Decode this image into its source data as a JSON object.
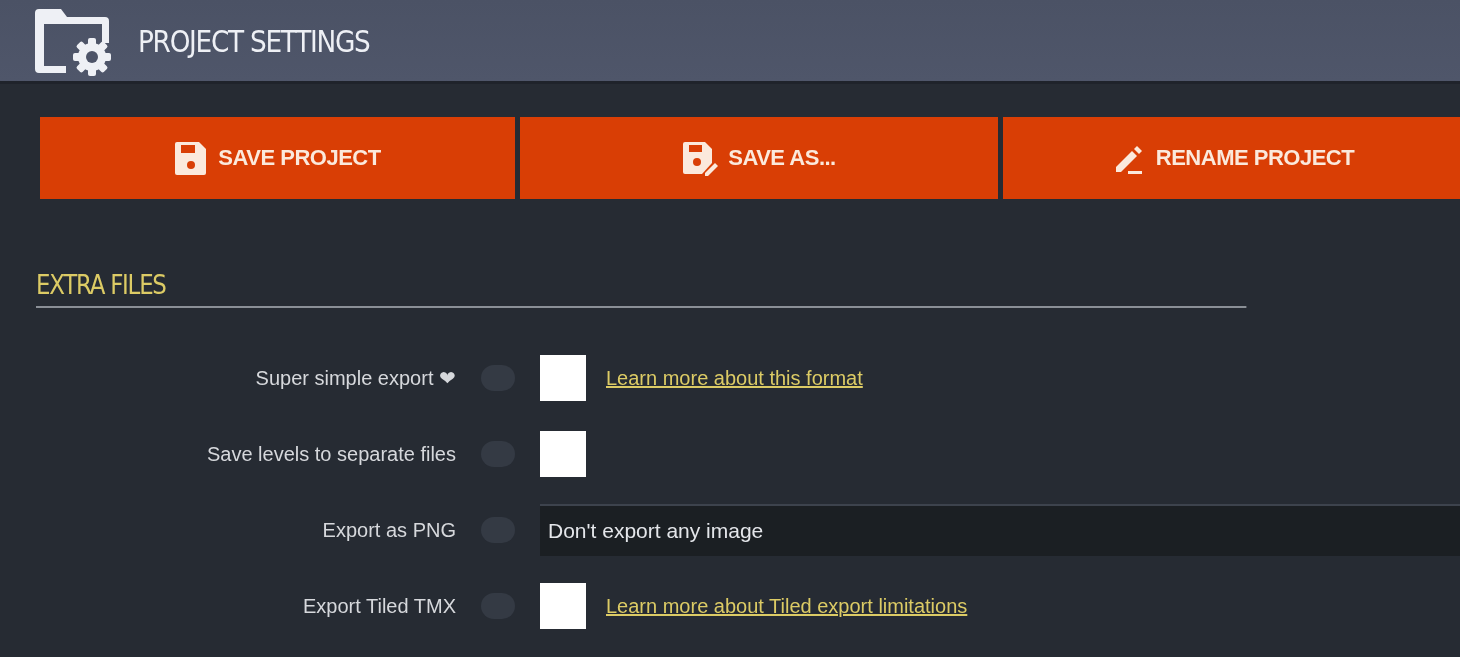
{
  "header": {
    "title": "PROJECT SETTINGS"
  },
  "actions": [
    {
      "kind": "save",
      "label": "SAVE PROJECT"
    },
    {
      "kind": "save-as",
      "label": "SAVE AS..."
    },
    {
      "kind": "rename",
      "label": "RENAME PROJECT"
    }
  ],
  "section": {
    "title": "EXTRA FILES",
    "rows": [
      {
        "kind": "checkbox",
        "label": "Super simple export ❤",
        "checked": false,
        "link": "Learn more about this format"
      },
      {
        "kind": "checkbox",
        "label": "Save levels to separate files",
        "checked": false
      },
      {
        "kind": "select",
        "label": "Export as PNG",
        "value": "Don't export any image"
      },
      {
        "kind": "checkbox",
        "label": "Export Tiled TMX",
        "checked": false,
        "link": "Learn more about Tiled export limitations"
      }
    ]
  }
}
